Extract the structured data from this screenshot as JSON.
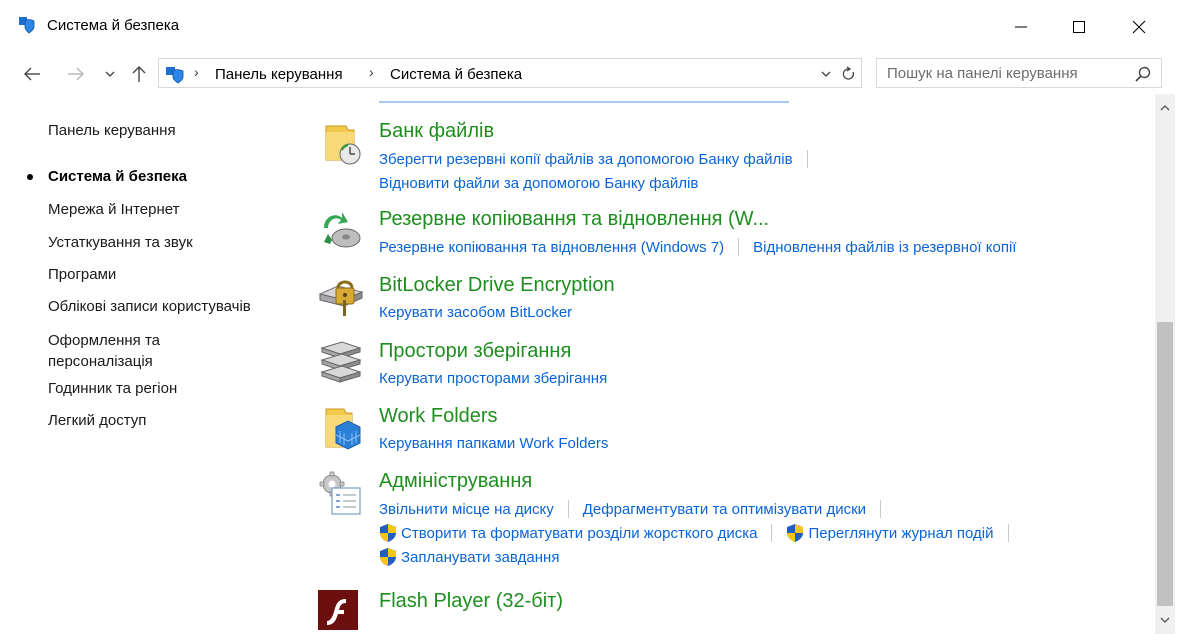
{
  "window": {
    "title": "Система й безпека",
    "minimize_label": "—",
    "maximize_label": "☐",
    "close_label": "✕"
  },
  "nav": {
    "back_icon": "arrow-left-icon",
    "forward_icon": "arrow-right-icon",
    "recent_icon": "chevron-down-icon",
    "up_icon": "arrow-up-icon"
  },
  "address": {
    "crumbs": [
      "Панель керування",
      "Система й безпека"
    ],
    "separator": "›"
  },
  "search": {
    "placeholder": "Пошук на панелі керування"
  },
  "sidebar": {
    "items": [
      {
        "label": "Панель керування",
        "active": false
      },
      {
        "label": "Система й безпека",
        "active": true
      },
      {
        "label": "Мережа й Інтернет",
        "active": false
      },
      {
        "label": "Устаткування та звук",
        "active": false
      },
      {
        "label": "Програми",
        "active": false
      },
      {
        "label": "Облікові записи користувачів",
        "active": false
      },
      {
        "label": "Оформлення та персоналізація",
        "active": false
      },
      {
        "label": "Годинник та регіон",
        "active": false
      },
      {
        "label": "Легкий доступ",
        "active": false
      }
    ]
  },
  "categories": [
    {
      "title": "Банк файлів",
      "icon": "file-history-icon",
      "links": [
        "Зберегти резервні копії файлів за допомогою Банку файлів",
        "Відновити файли за допомогою Банку файлів"
      ]
    },
    {
      "title": "Резервне копіювання та відновлення (W...",
      "icon": "backup-restore-icon",
      "links": [
        "Резервне копіювання та відновлення (Windows 7)",
        "Відновлення файлів із резервної копії"
      ]
    },
    {
      "title": "BitLocker Drive Encryption",
      "icon": "bitlocker-icon",
      "links": [
        "Керувати засобом BitLocker"
      ]
    },
    {
      "title": "Простори зберігання",
      "icon": "storage-spaces-icon",
      "links": [
        "Керувати просторами зберігання"
      ]
    },
    {
      "title": "Work Folders",
      "icon": "work-folders-icon",
      "links": [
        "Керування папками Work Folders"
      ]
    },
    {
      "title": "Адміністрування",
      "icon": "admin-tools-icon",
      "links": [
        "Звільнити місце на диску",
        "Дефрагментувати та оптимізувати диски",
        "Створити та форматувати розділи жорсткого диска",
        "Переглянути журнал подій",
        "Запланувати завдання"
      ]
    },
    {
      "title": "Flash Player (32-біт)",
      "icon": "flash-player-icon",
      "links": []
    }
  ],
  "colors": {
    "category_title": "#1e8e1e",
    "link": "#0a64d6",
    "scroll_thumb": "#c1c1c1"
  }
}
